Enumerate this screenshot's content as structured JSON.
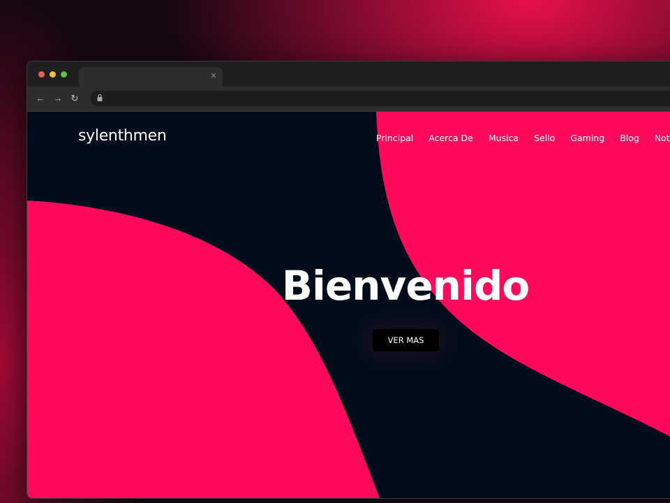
{
  "colors": {
    "accent": "#ff0a5a",
    "page_background": "#020d1c",
    "button_background": "#000000",
    "text": "#ffffff"
  },
  "browser": {
    "window_controls": [
      "close",
      "minimize",
      "maximize"
    ],
    "tab": {
      "title": "",
      "close_icon": "close-icon"
    },
    "toolbar": {
      "back_icon": "arrow-left-icon",
      "forward_icon": "arrow-right-icon",
      "reload_icon": "reload-icon",
      "url": "",
      "lock_icon": "lock-icon"
    }
  },
  "site": {
    "logo": "sylenthmen",
    "nav": [
      "Principal",
      "Acerca De",
      "Musica",
      "Sello",
      "Gaming",
      "Blog",
      "Notc"
    ],
    "hero": {
      "title": "Bienvenido",
      "button_label": "VER MAS"
    }
  }
}
